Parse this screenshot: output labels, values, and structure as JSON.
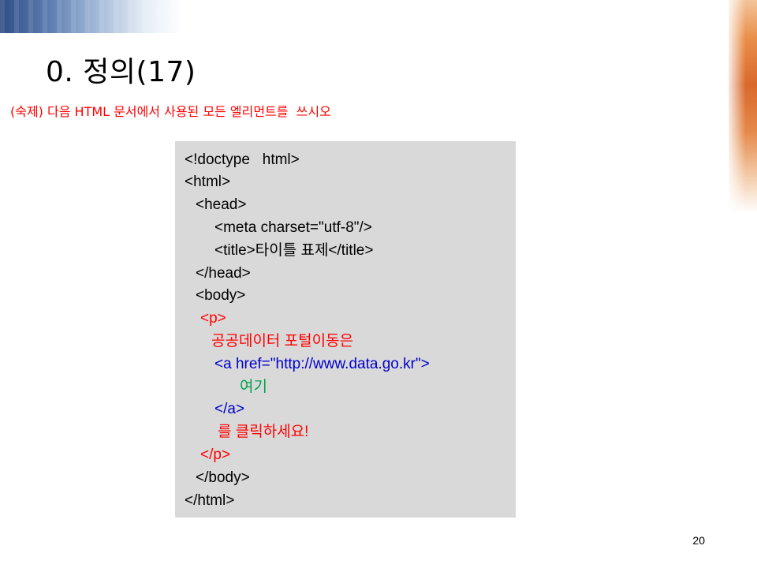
{
  "slide": {
    "title": "0. 정의(17)",
    "homework": "(숙제) 다음 HTML 문서에서 사용된 모든 엘리먼트를  쓰시오",
    "page_number": "20"
  },
  "code": {
    "lines": [
      "<!doctype   html>",
      "<html>",
      "<head>",
      "<meta charset=\"utf-8\"/>",
      "<title>타이틀 표제</title>",
      "</head>",
      "<body>",
      "<p>",
      "공공데이터 포털이동은",
      "<a href=\"http://www.data.go.kr\">",
      "여기",
      "</a>",
      "를 클릭하세요!",
      "</p>",
      "</body>",
      "</html>"
    ]
  },
  "colors": {
    "red_text": "#ff0000",
    "blue_text": "#0000cc",
    "green_text": "#00a050",
    "code_bg": "#d9d9d9",
    "top_band": "#2f4d86",
    "right_band": "#d9692b"
  }
}
